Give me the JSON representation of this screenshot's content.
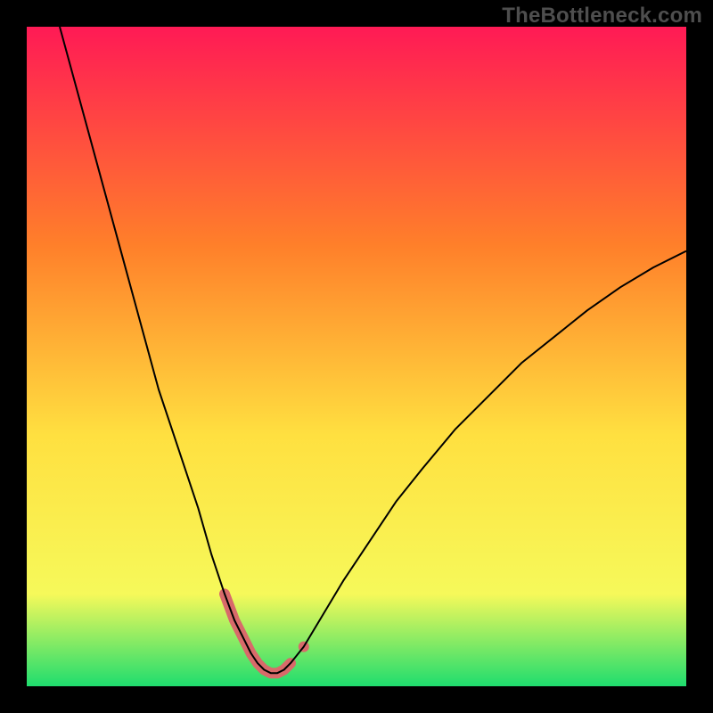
{
  "watermark": "TheBottleneck.com",
  "chart_data": {
    "type": "line",
    "title": "",
    "xlabel": "",
    "ylabel": "",
    "xlim": [
      0,
      100
    ],
    "ylim": [
      0,
      100
    ],
    "grid": false,
    "axes_visible": false,
    "background_gradient": {
      "top": "#ff1a55",
      "mid_upper": "#ff7f2a",
      "mid": "#ffe040",
      "mid_lower": "#f6f95a",
      "bottom": "#1fdd6e"
    },
    "series": [
      {
        "name": "bottleneck-curve",
        "color": "#000000",
        "stroke_width": 2,
        "x": [
          5,
          8,
          11,
          14,
          17,
          20,
          23,
          26,
          28,
          30,
          31.5,
          33,
          34,
          35,
          36,
          37,
          38,
          39,
          40,
          42,
          45,
          48,
          52,
          56,
          60,
          65,
          70,
          75,
          80,
          85,
          90,
          95,
          100
        ],
        "y": [
          100,
          89,
          78,
          67,
          56,
          45,
          36,
          27,
          20,
          14,
          10,
          7,
          5,
          3.5,
          2.5,
          2,
          2,
          2.5,
          3.5,
          6,
          11,
          16,
          22,
          28,
          33,
          39,
          44,
          49,
          53,
          57,
          60.5,
          63.5,
          66
        ]
      }
    ],
    "highlight_band": {
      "name": "optimal-range",
      "color": "#d86a6a",
      "stroke_width": 12,
      "x": [
        30,
        31.5,
        33,
        34,
        35,
        36,
        37,
        38,
        39,
        40
      ],
      "y": [
        14,
        10,
        7,
        5,
        3.5,
        2.5,
        2,
        2,
        2.5,
        3.5
      ]
    },
    "highlight_end_dot": {
      "x": 42,
      "y": 6,
      "r": 6,
      "color": "#d86a6a"
    }
  }
}
